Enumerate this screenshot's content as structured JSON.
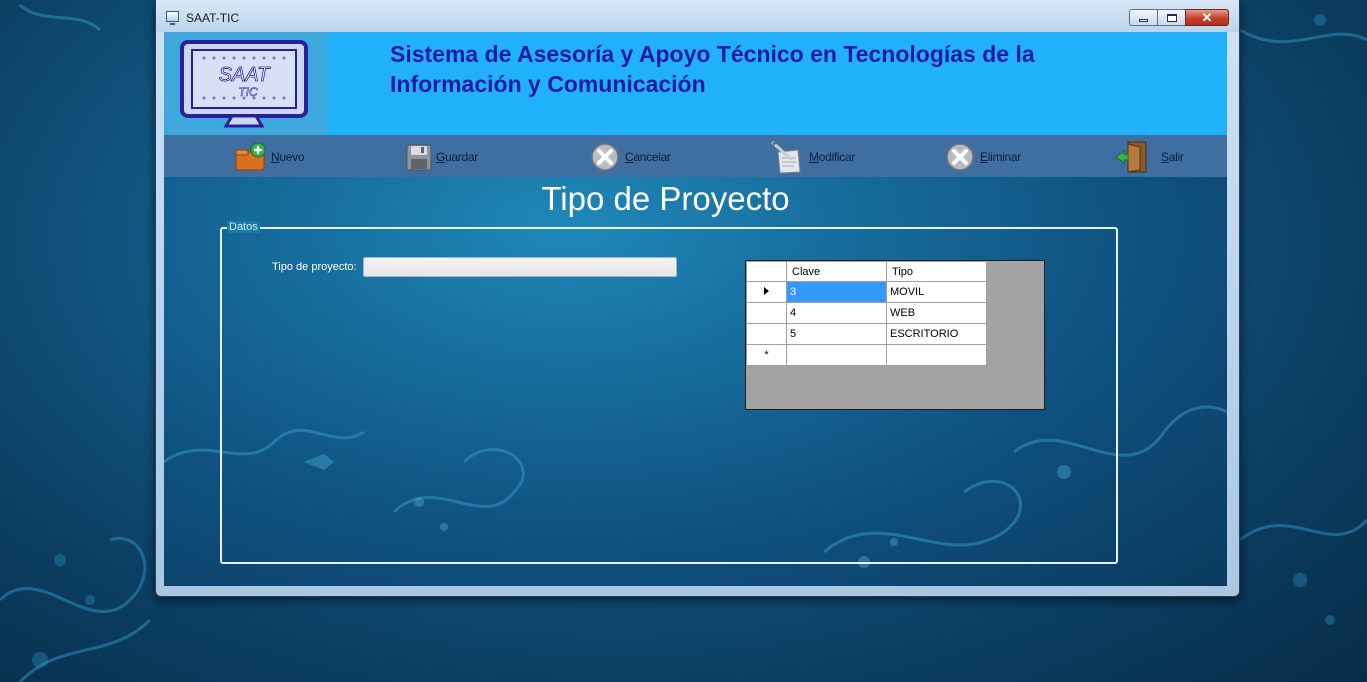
{
  "window": {
    "title": "SAAT-TIC",
    "controls": {
      "minimize": "minimize-icon",
      "maximize": "maximize-icon",
      "close": "close-icon"
    }
  },
  "banner": {
    "logo_text_top": "SAAT",
    "logo_text_bottom": "TIC",
    "title": "Sistema de Asesoría y Apoyo Técnico en Tecnologías de la Información y Comunicación"
  },
  "toolbar": {
    "items": [
      {
        "key": "nuevo",
        "first": "N",
        "rest": "uevo",
        "icon": "new-folder-icon"
      },
      {
        "key": "guardar",
        "first": "G",
        "rest": "uardar",
        "icon": "floppy-disk-icon"
      },
      {
        "key": "cancelar",
        "first": "C",
        "rest": "ancelar",
        "icon": "cancel-icon"
      },
      {
        "key": "modificar",
        "first": "M",
        "rest": "odificar",
        "icon": "edit-note-icon"
      },
      {
        "key": "eliminar",
        "first": "E",
        "rest": "liminar",
        "icon": "delete-icon"
      },
      {
        "key": "salir",
        "first": "S",
        "rest": "alir",
        "icon": "exit-door-icon"
      }
    ]
  },
  "page": {
    "title": "Tipo de Proyecto"
  },
  "form": {
    "group_label": "Datos",
    "tipo_label": "Tipo de proyecto:",
    "tipo_value": ""
  },
  "grid": {
    "columns": [
      "Clave",
      "Tipo"
    ],
    "rows": [
      {
        "clave": "3",
        "tipo": "MOVIL"
      },
      {
        "clave": "4",
        "tipo": "WEB"
      },
      {
        "clave": "5",
        "tipo": "ESCRITORIO"
      }
    ],
    "new_row_marker": "*"
  },
  "colors": {
    "banner_bg": "#21b1fa",
    "banner_title": "#1e1aa8",
    "toolbar_bg": "#3f6fa0",
    "selection": "#3399ff"
  }
}
